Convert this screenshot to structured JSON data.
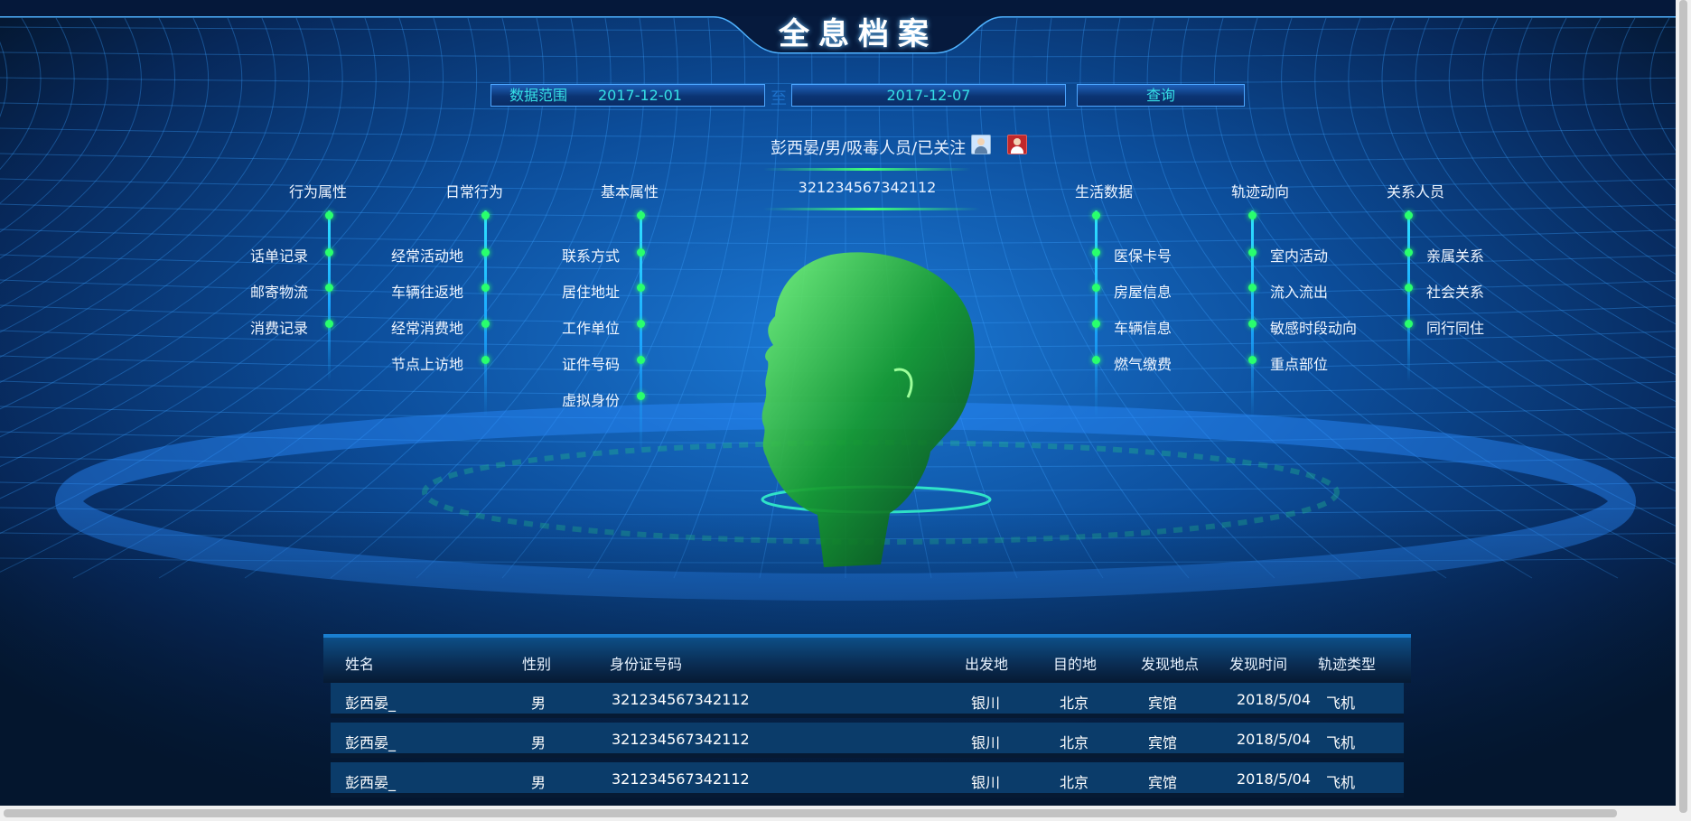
{
  "header": {
    "title": "全息档案"
  },
  "filter": {
    "range_label": "数据范围",
    "start_date": "2017-12-01",
    "separator": "至",
    "end_date": "2017-12-07",
    "query_label": "查询"
  },
  "person": {
    "summary": "彭西晏/男/吸毒人员/已关注",
    "id_number": "321234567342112",
    "avatar_icons": [
      "person-avatar-icon",
      "person-avatar-red-icon"
    ]
  },
  "categories_left": [
    {
      "title": "行为属性",
      "items": [
        "话单记录",
        "邮寄物流",
        "消费记录"
      ]
    },
    {
      "title": "日常行为",
      "items": [
        "经常活动地",
        "车辆往返地",
        "经常消费地",
        "节点上访地"
      ]
    },
    {
      "title": "基本属性",
      "items": [
        "联系方式",
        "居住地址",
        "工作单位",
        "证件号码",
        "虚拟身份"
      ]
    }
  ],
  "categories_right": [
    {
      "title": "生活数据",
      "items": [
        "医保卡号",
        "房屋信息",
        "车辆信息",
        "燃气缴费"
      ]
    },
    {
      "title": "轨迹动向",
      "items": [
        "室内活动",
        "流入流出",
        "敏感时段动向",
        "重点部位"
      ]
    },
    {
      "title": "关系人员",
      "items": [
        "亲属关系",
        "社会关系",
        "同行同住"
      ]
    }
  ],
  "table": {
    "headers": [
      "姓名",
      "性别",
      "身份证号码",
      "出发地",
      "目的地",
      "发现地点",
      "发现时间",
      "轨迹类型"
    ],
    "rows": [
      [
        "彭西晏_",
        "男",
        "321234567342112",
        "银川",
        "北京",
        "宾馆",
        "2018/5/04",
        "飞机"
      ],
      [
        "彭西晏_",
        "男",
        "321234567342112",
        "银川",
        "北京",
        "宾馆",
        "2018/5/04",
        "飞机"
      ],
      [
        "彭西晏_",
        "男",
        "321234567342112",
        "银川",
        "北京",
        "宾馆",
        "2018/5/04",
        "飞机"
      ]
    ]
  },
  "colors": {
    "accent": "#36e0e6",
    "node": "#29ff6d",
    "line": "#2fe3ff",
    "background": "#04162e"
  }
}
